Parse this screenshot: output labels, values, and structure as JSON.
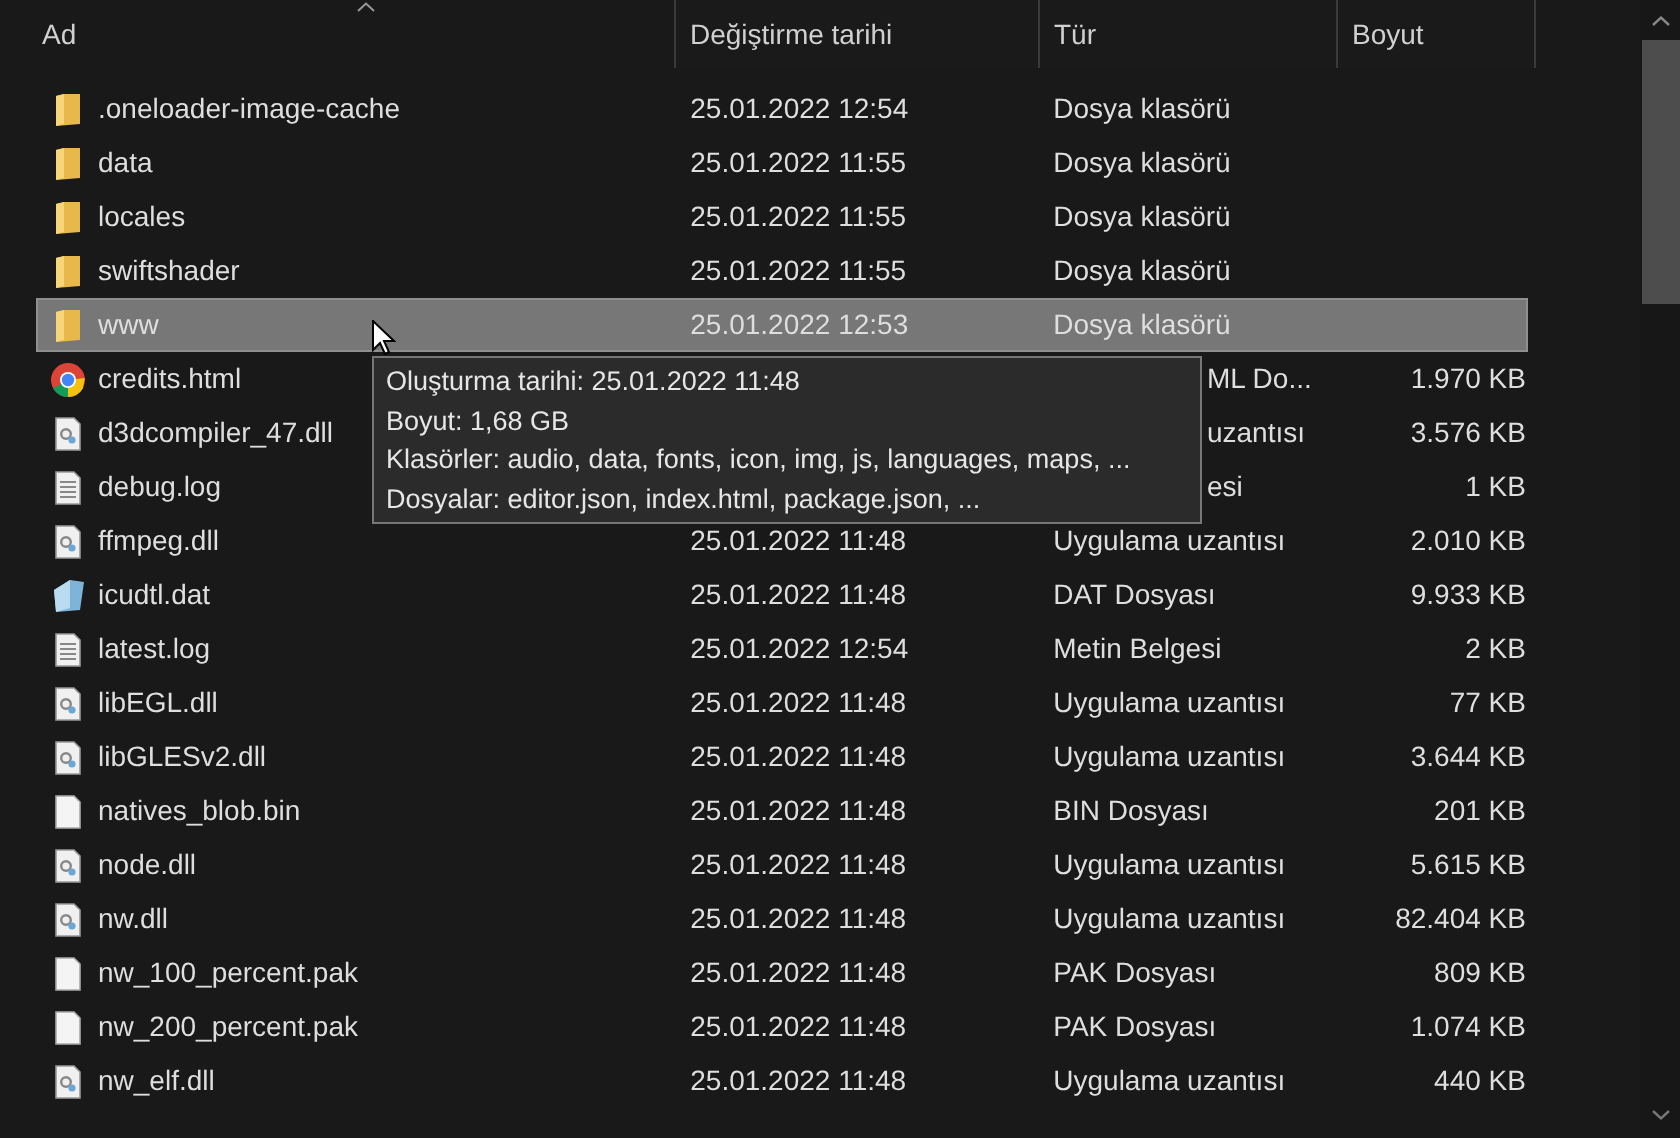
{
  "columns": [
    {
      "label": "Ad",
      "sorted": true
    },
    {
      "label": "Değiştirme tarihi",
      "sorted": false
    },
    {
      "label": "Tür",
      "sorted": false
    },
    {
      "label": "Boyut",
      "sorted": false
    }
  ],
  "rows": [
    {
      "kind": "folder",
      "name": ".oneloader-image-cache",
      "date": "25.01.2022 12:54",
      "type": "Dosya klasörü",
      "selected": false,
      "covered": false
    },
    {
      "kind": "folder",
      "name": "data",
      "date": "25.01.2022 11:55",
      "type": "Dosya klasörü",
      "selected": false,
      "covered": false
    },
    {
      "kind": "folder",
      "name": "locales",
      "date": "25.01.2022 11:55",
      "type": "Dosya klasörü",
      "selected": false,
      "covered": false
    },
    {
      "kind": "folder",
      "name": "swiftshader",
      "date": "25.01.2022 11:55",
      "type": "Dosya klasörü",
      "selected": false,
      "covered": false
    },
    {
      "kind": "folder",
      "name": "www",
      "date": "25.01.2022 12:53",
      "type": "Dosya klasörü",
      "selected": true,
      "covered": false
    },
    {
      "kind": "chrome",
      "name": "credits.html",
      "type": "ML Do...",
      "size": "1.970 KB",
      "selected": false,
      "covered": true
    },
    {
      "kind": "dll",
      "name": "d3dcompiler_47.dll",
      "type": "uzantısı",
      "size": "3.576 KB",
      "selected": false,
      "covered": true
    },
    {
      "kind": "log",
      "name": "debug.log",
      "type": "esi",
      "size": "1 KB",
      "selected": false,
      "covered": true
    },
    {
      "kind": "dll",
      "name": "ffmpeg.dll",
      "date": "25.01.2022 11:48",
      "type": "Uygulama uzantısı",
      "size": "2.010 KB",
      "selected": false,
      "covered": false
    },
    {
      "kind": "dat",
      "name": "icudtl.dat",
      "date": "25.01.2022 11:48",
      "type": "DAT Dosyası",
      "size": "9.933 KB",
      "selected": false,
      "covered": false
    },
    {
      "kind": "log",
      "name": "latest.log",
      "date": "25.01.2022 12:54",
      "type": "Metin Belgesi",
      "size": "2 KB",
      "selected": false,
      "covered": false
    },
    {
      "kind": "dll",
      "name": "libEGL.dll",
      "date": "25.01.2022 11:48",
      "type": "Uygulama uzantısı",
      "size": "77 KB",
      "selected": false,
      "covered": false
    },
    {
      "kind": "dll",
      "name": "libGLESv2.dll",
      "date": "25.01.2022 11:48",
      "type": "Uygulama uzantısı",
      "size": "3.644 KB",
      "selected": false,
      "covered": false
    },
    {
      "kind": "blank",
      "name": "natives_blob.bin",
      "date": "25.01.2022 11:48",
      "type": "BIN Dosyası",
      "size": "201 KB",
      "selected": false,
      "covered": false
    },
    {
      "kind": "dll",
      "name": "node.dll",
      "date": "25.01.2022 11:48",
      "type": "Uygulama uzantısı",
      "size": "5.615 KB",
      "selected": false,
      "covered": false
    },
    {
      "kind": "dll",
      "name": "nw.dll",
      "date": "25.01.2022 11:48",
      "type": "Uygulama uzantısı",
      "size": "82.404 KB",
      "selected": false,
      "covered": false
    },
    {
      "kind": "blank",
      "name": "nw_100_percent.pak",
      "date": "25.01.2022 11:48",
      "type": "PAK Dosyası",
      "size": "809 KB",
      "selected": false,
      "covered": false
    },
    {
      "kind": "blank",
      "name": "nw_200_percent.pak",
      "date": "25.01.2022 11:48",
      "type": "PAK Dosyası",
      "size": "1.074 KB",
      "selected": false,
      "covered": false
    },
    {
      "kind": "dll",
      "name": "nw_elf.dll",
      "date": "25.01.2022 11:48",
      "type": "Uygulama uzantısı",
      "size": "440 KB",
      "selected": false,
      "covered": false
    }
  ],
  "tooltip": {
    "lines": [
      "Oluşturma tarihi: 25.01.2022 11:48",
      "Boyut: 1,68 GB",
      "Klasörler: audio, data, fonts, icon, img, js, languages, maps, ...",
      "Dosyalar: editor.json, index.html, package.json, ..."
    ]
  }
}
